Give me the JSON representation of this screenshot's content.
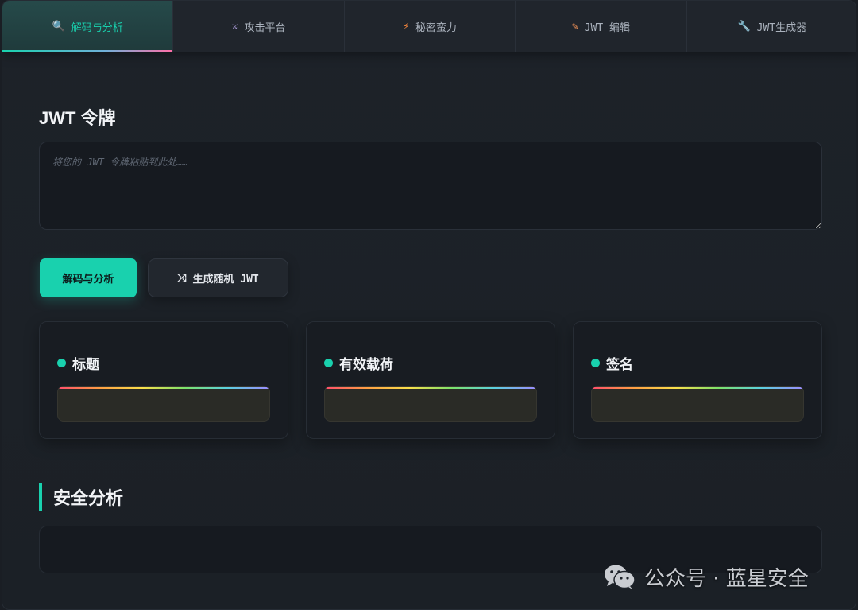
{
  "tabs": [
    {
      "icon": "search-icon",
      "glyph": "🔍",
      "label": "解码与分析"
    },
    {
      "icon": "crossed-swords-icon",
      "glyph": "⚔",
      "label": "攻击平台"
    },
    {
      "icon": "bolt-icon",
      "glyph": "⚡",
      "label": "秘密蛮力"
    },
    {
      "icon": "pencil-icon",
      "glyph": "✎",
      "label": "JWT 编辑"
    },
    {
      "icon": "wrench-icon",
      "glyph": "🔧",
      "label": "JWT生成器"
    }
  ],
  "token": {
    "title": "JWT 令牌",
    "placeholder": "将您的 JWT 令牌粘贴到此处……"
  },
  "buttons": {
    "decode": "解码与分析",
    "random_icon": "shuffle-icon",
    "random_glyph": "⤮",
    "random": "生成随机 JWT"
  },
  "cards": [
    {
      "title": "标题"
    },
    {
      "title": "有效载荷"
    },
    {
      "title": "签名"
    }
  ],
  "security": {
    "title": "安全分析"
  },
  "watermark": {
    "text": "公众号 · 蓝星安全"
  },
  "colors": {
    "accent": "#19d1ae",
    "background": "#1c2127"
  }
}
